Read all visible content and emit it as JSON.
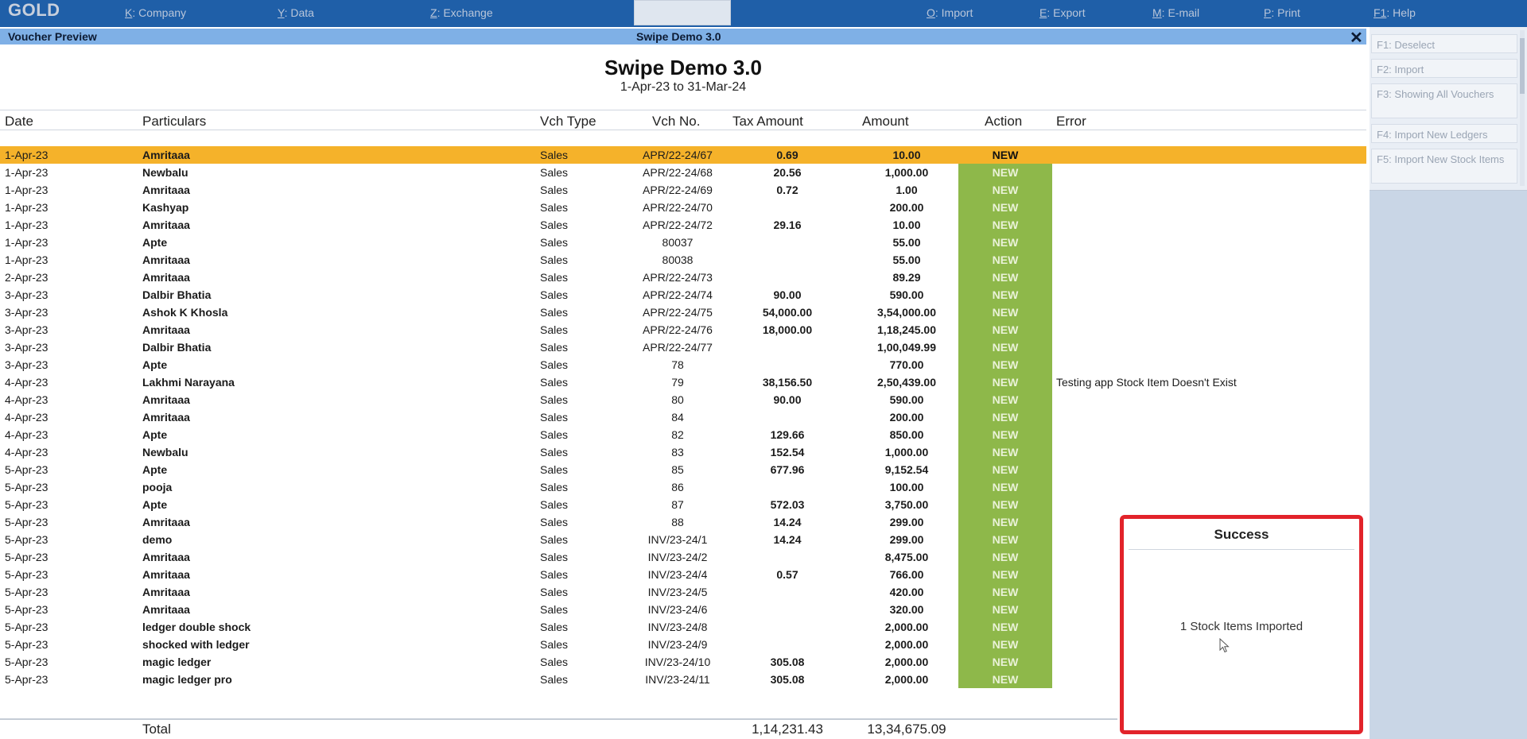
{
  "topbar": {
    "logo": "GOLD",
    "menu": [
      {
        "key": "K",
        "label": ": Company"
      },
      {
        "key": "Y",
        "label": ": Data"
      },
      {
        "key": "Z",
        "label": ": Exchange"
      },
      {
        "key": "O",
        "label": ": Import"
      },
      {
        "key": "E",
        "label": ": Export"
      },
      {
        "key": "M",
        "label": ": E-mail"
      },
      {
        "key": "P",
        "label": ": Print"
      },
      {
        "key": "F1",
        "label": ": Help"
      }
    ]
  },
  "subbar": {
    "left": "Voucher Preview",
    "center": "Swipe Demo 3.0",
    "close": "✕"
  },
  "sidebar": {
    "buttons": [
      "F1: Deselect",
      "F2: Import",
      "F3: Showing All Vouchers",
      "F4: Import New Ledgers",
      "F5: Import New Stock Items"
    ]
  },
  "report": {
    "company": "Swipe Demo 3.0",
    "period": "1-Apr-23 to 31-Mar-24",
    "columns": {
      "date": "Date",
      "particulars": "Particulars",
      "vch_type": "Vch Type",
      "vch_no": "Vch No.",
      "tax_amount": "Tax Amount",
      "amount": "Amount",
      "action": "Action",
      "error": "Error"
    },
    "rows": [
      {
        "date": "1-Apr-23",
        "particulars": "Amritaaa",
        "vch_type": "Sales",
        "vch_no": "APR/22-24/67",
        "tax": "0.69",
        "amount": "10.00",
        "action": "NEW",
        "error": ""
      },
      {
        "date": "1-Apr-23",
        "particulars": "Newbalu",
        "vch_type": "Sales",
        "vch_no": "APR/22-24/68",
        "tax": "20.56",
        "amount": "1,000.00",
        "action": "NEW",
        "error": ""
      },
      {
        "date": "1-Apr-23",
        "particulars": "Amritaaa",
        "vch_type": "Sales",
        "vch_no": "APR/22-24/69",
        "tax": "0.72",
        "amount": "1.00",
        "action": "NEW",
        "error": ""
      },
      {
        "date": "1-Apr-23",
        "particulars": "Kashyap",
        "vch_type": "Sales",
        "vch_no": "APR/22-24/70",
        "tax": "",
        "amount": "200.00",
        "action": "NEW",
        "error": ""
      },
      {
        "date": "1-Apr-23",
        "particulars": "Amritaaa",
        "vch_type": "Sales",
        "vch_no": "APR/22-24/72",
        "tax": "29.16",
        "amount": "10.00",
        "action": "NEW",
        "error": ""
      },
      {
        "date": "1-Apr-23",
        "particulars": "Apte",
        "vch_type": "Sales",
        "vch_no": "80037",
        "tax": "",
        "amount": "55.00",
        "action": "NEW",
        "error": ""
      },
      {
        "date": "1-Apr-23",
        "particulars": "Amritaaa",
        "vch_type": "Sales",
        "vch_no": "80038",
        "tax": "",
        "amount": "55.00",
        "action": "NEW",
        "error": ""
      },
      {
        "date": "2-Apr-23",
        "particulars": "Amritaaa",
        "vch_type": "Sales",
        "vch_no": "APR/22-24/73",
        "tax": "",
        "amount": "89.29",
        "action": "NEW",
        "error": ""
      },
      {
        "date": "3-Apr-23",
        "particulars": "Dalbir Bhatia",
        "vch_type": "Sales",
        "vch_no": "APR/22-24/74",
        "tax": "90.00",
        "amount": "590.00",
        "action": "NEW",
        "error": ""
      },
      {
        "date": "3-Apr-23",
        "particulars": "Ashok K Khosla",
        "vch_type": "Sales",
        "vch_no": "APR/22-24/75",
        "tax": "54,000.00",
        "amount": "3,54,000.00",
        "action": "NEW",
        "error": ""
      },
      {
        "date": "3-Apr-23",
        "particulars": "Amritaaa",
        "vch_type": "Sales",
        "vch_no": "APR/22-24/76",
        "tax": "18,000.00",
        "amount": "1,18,245.00",
        "action": "NEW",
        "error": ""
      },
      {
        "date": "3-Apr-23",
        "particulars": "Dalbir Bhatia",
        "vch_type": "Sales",
        "vch_no": "APR/22-24/77",
        "tax": "",
        "amount": "1,00,049.99",
        "action": "NEW",
        "error": ""
      },
      {
        "date": "3-Apr-23",
        "particulars": "Apte",
        "vch_type": "Sales",
        "vch_no": "78",
        "tax": "",
        "amount": "770.00",
        "action": "NEW",
        "error": ""
      },
      {
        "date": "4-Apr-23",
        "particulars": "Lakhmi Narayana",
        "vch_type": "Sales",
        "vch_no": "79",
        "tax": "38,156.50",
        "amount": "2,50,439.00",
        "action": "NEW",
        "error": "Testing app Stock Item Doesn't Exist"
      },
      {
        "date": "4-Apr-23",
        "particulars": "Amritaaa",
        "vch_type": "Sales",
        "vch_no": "80",
        "tax": "90.00",
        "amount": "590.00",
        "action": "NEW",
        "error": ""
      },
      {
        "date": "4-Apr-23",
        "particulars": "Amritaaa",
        "vch_type": "Sales",
        "vch_no": "84",
        "tax": "",
        "amount": "200.00",
        "action": "NEW",
        "error": ""
      },
      {
        "date": "4-Apr-23",
        "particulars": "Apte",
        "vch_type": "Sales",
        "vch_no": "82",
        "tax": "129.66",
        "amount": "850.00",
        "action": "NEW",
        "error": ""
      },
      {
        "date": "4-Apr-23",
        "particulars": "Newbalu",
        "vch_type": "Sales",
        "vch_no": "83",
        "tax": "152.54",
        "amount": "1,000.00",
        "action": "NEW",
        "error": ""
      },
      {
        "date": "5-Apr-23",
        "particulars": "Apte",
        "vch_type": "Sales",
        "vch_no": "85",
        "tax": "677.96",
        "amount": "9,152.54",
        "action": "NEW",
        "error": ""
      },
      {
        "date": "5-Apr-23",
        "particulars": "pooja",
        "vch_type": "Sales",
        "vch_no": "86",
        "tax": "",
        "amount": "100.00",
        "action": "NEW",
        "error": ""
      },
      {
        "date": "5-Apr-23",
        "particulars": "Apte",
        "vch_type": "Sales",
        "vch_no": "87",
        "tax": "572.03",
        "amount": "3,750.00",
        "action": "NEW",
        "error": ""
      },
      {
        "date": "5-Apr-23",
        "particulars": "Amritaaa",
        "vch_type": "Sales",
        "vch_no": "88",
        "tax": "14.24",
        "amount": "299.00",
        "action": "NEW",
        "error": ""
      },
      {
        "date": "5-Apr-23",
        "particulars": "demo",
        "vch_type": "Sales",
        "vch_no": "INV/23-24/1",
        "tax": "14.24",
        "amount": "299.00",
        "action": "NEW",
        "error": ""
      },
      {
        "date": "5-Apr-23",
        "particulars": "Amritaaa",
        "vch_type": "Sales",
        "vch_no": "INV/23-24/2",
        "tax": "",
        "amount": "8,475.00",
        "action": "NEW",
        "error": ""
      },
      {
        "date": "5-Apr-23",
        "particulars": "Amritaaa",
        "vch_type": "Sales",
        "vch_no": "INV/23-24/4",
        "tax": "0.57",
        "amount": "766.00",
        "action": "NEW",
        "error": ""
      },
      {
        "date": "5-Apr-23",
        "particulars": "Amritaaa",
        "vch_type": "Sales",
        "vch_no": "INV/23-24/5",
        "tax": "",
        "amount": "420.00",
        "action": "NEW",
        "error": ""
      },
      {
        "date": "5-Apr-23",
        "particulars": "Amritaaa",
        "vch_type": "Sales",
        "vch_no": "INV/23-24/6",
        "tax": "",
        "amount": "320.00",
        "action": "NEW",
        "error": ""
      },
      {
        "date": "5-Apr-23",
        "particulars": "ledger double shock",
        "vch_type": "Sales",
        "vch_no": "INV/23-24/8",
        "tax": "",
        "amount": "2,000.00",
        "action": "NEW",
        "error": ""
      },
      {
        "date": "5-Apr-23",
        "particulars": "shocked with ledger",
        "vch_type": "Sales",
        "vch_no": "INV/23-24/9",
        "tax": "",
        "amount": "2,000.00",
        "action": "NEW",
        "error": ""
      },
      {
        "date": "5-Apr-23",
        "particulars": "magic ledger",
        "vch_type": "Sales",
        "vch_no": "INV/23-24/10",
        "tax": "305.08",
        "amount": "2,000.00",
        "action": "NEW",
        "error": ""
      },
      {
        "date": "5-Apr-23",
        "particulars": "magic ledger pro",
        "vch_type": "Sales",
        "vch_no": "INV/23-24/11",
        "tax": "305.08",
        "amount": "2,000.00",
        "action": "NEW",
        "error": ""
      }
    ],
    "total": {
      "label": "Total",
      "tax": "1,14,231.43",
      "amount": "13,34,675.09"
    }
  },
  "popup": {
    "title": "Success",
    "message": "1 Stock Items Imported"
  },
  "colors": {
    "topbar": "#1f5fa8",
    "subbar": "#7fb0e6",
    "highlight_row": "#f5b22a",
    "action_cell": "#8eb84a",
    "popup_border": "#e2232a"
  }
}
